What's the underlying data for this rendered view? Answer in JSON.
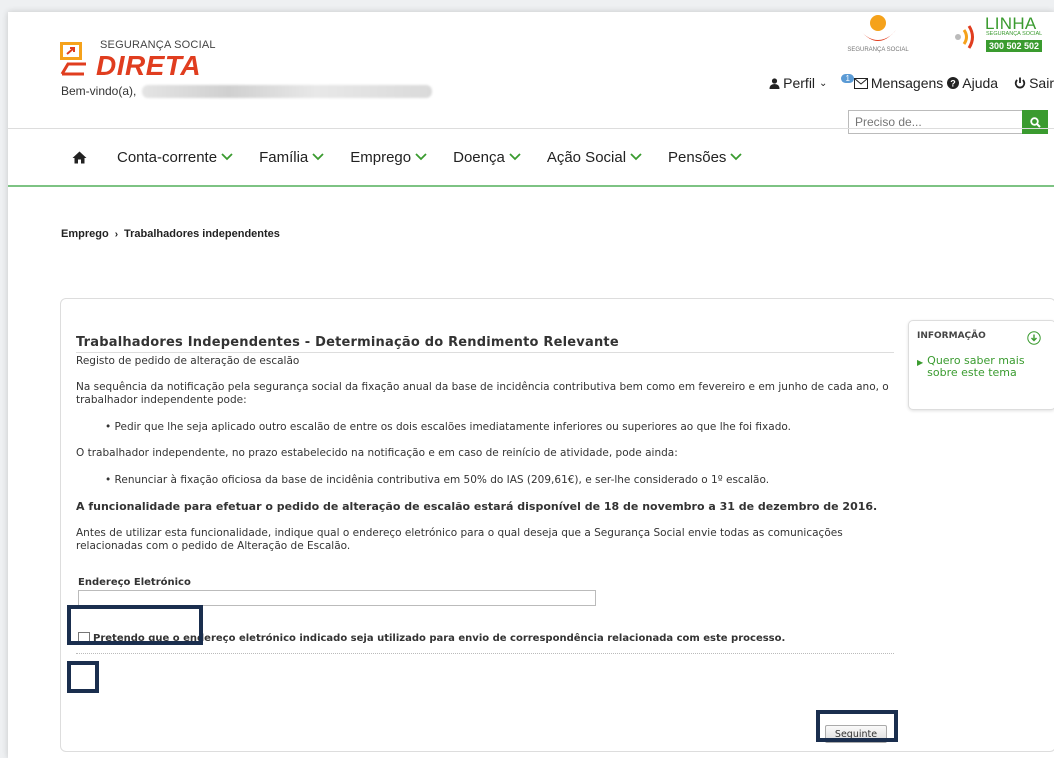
{
  "brand": {
    "small_text": "SEGURANÇA SOCIAL",
    "big_text": "DIRETA",
    "seg_social_label": "SEGURANÇA SOCIAL",
    "linha_word": "LINHA",
    "linha_sub": "SEGURANÇA SOCIAL",
    "linha_phone": "300 502 502"
  },
  "header": {
    "welcome": "Bem-vindo(a),",
    "perfil": "Perfil",
    "messages_badge": "1",
    "mensagens": "Mensagens",
    "ajuda": "Ajuda",
    "sair": "Sair",
    "search_placeholder": "Preciso de..."
  },
  "nav": {
    "items": [
      {
        "label": "Conta-corrente"
      },
      {
        "label": "Família"
      },
      {
        "label": "Emprego"
      },
      {
        "label": "Doença"
      },
      {
        "label": "Ação Social"
      },
      {
        "label": "Pensões"
      }
    ]
  },
  "breadcrumb": {
    "parent": "Emprego",
    "current": "Trabalhadores independentes"
  },
  "main": {
    "title": "Trabalhadores Independentes - Determinação do Rendimento Relevante",
    "subtitle": "Registo de pedido de alteração de escalão",
    "para1": "Na sequência da notificação pela segurança social da fixação anual da base de incidência contributiva bem como em fevereiro e em junho de cada ano, o trabalhador independente pode:",
    "bullet1": "• Pedir que lhe seja aplicado outro escalão de entre os dois escalões imediatamente inferiores ou superiores ao que lhe foi fixado.",
    "para2": "O trabalhador independente, no prazo estabelecido na notificação e em caso de reinício de atividade, pode ainda:",
    "bullet2": "• Renunciar à fixação oficiosa da base de incidênia contributiva em 50% do IAS (209,61€), e ser-lhe considerado o 1º escalão.",
    "bold_para": "A funcionalidade para efetuar o pedido de alteração de escalão estará disponível de 18 de novembro a 31 de dezembro de 2016.",
    "para3": "Antes de utilizar esta funcionalidade, indique qual o endereço eletrónico para o qual deseja que a Segurança Social envie todas as comunicações relacionadas com o pedido de Alteração de Escalão.",
    "email_label": "Endereço Eletrónico",
    "email_value": "",
    "checkbox_label": "Pretendo que o endereço eletrónico indicado seja utilizado para envio de correspondência relacionada com este processo.",
    "next_button": "Seguinte"
  },
  "info": {
    "title": "INFORMAÇÃO",
    "link": "Quero saber mais sobre este tema"
  },
  "colors": {
    "accent_green": "#3a9b2f",
    "brand_red": "#e03d1f",
    "highlight_box": "#1a2e4e"
  }
}
